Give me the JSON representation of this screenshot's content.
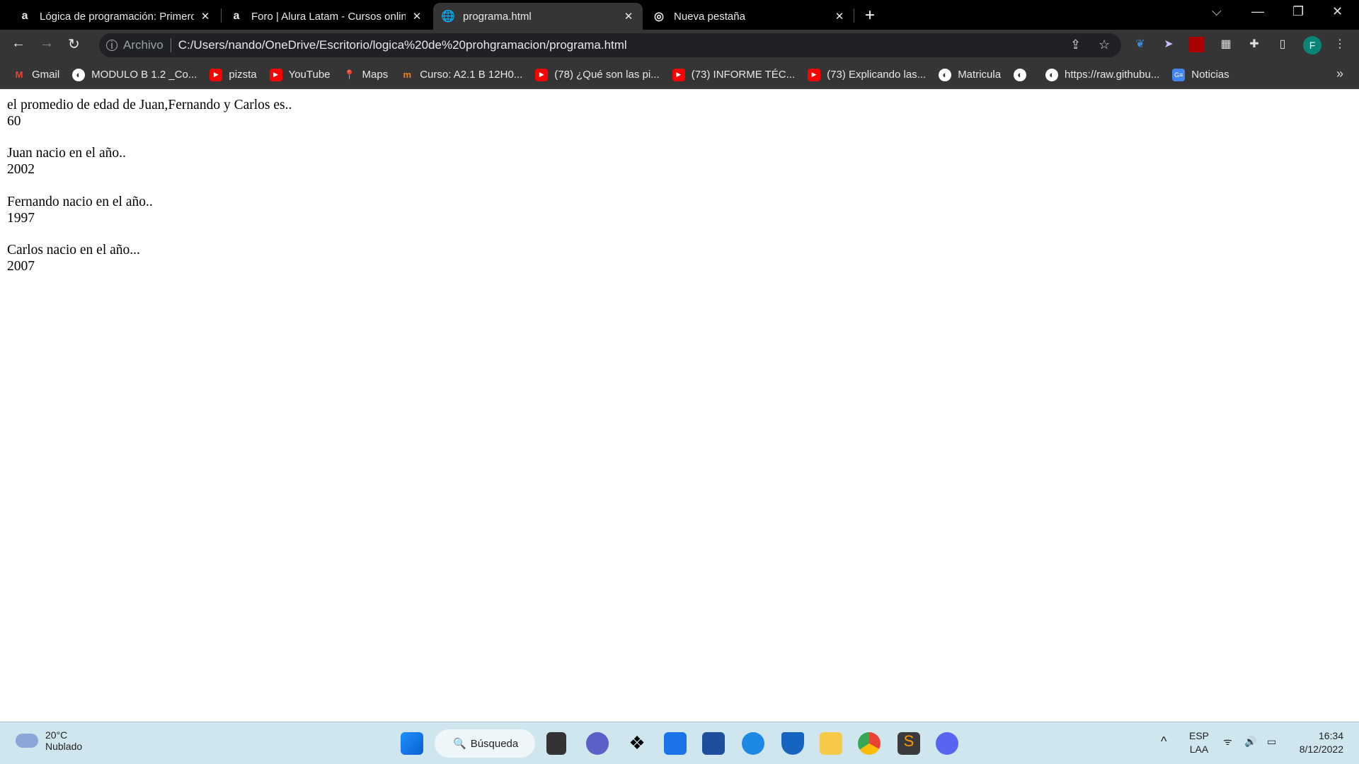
{
  "browser": {
    "tabs": [
      {
        "title": "Lógica de programación: Primeros",
        "icon": "alura-icon",
        "active": false
      },
      {
        "title": "Foro | Alura Latam - Cursos online",
        "icon": "alura-icon",
        "active": false
      },
      {
        "title": "programa.html",
        "icon": "globe-icon",
        "active": true
      },
      {
        "title": "Nueva pestaña",
        "icon": "chrome-icon",
        "active": false
      }
    ],
    "address": {
      "scheme_label": "Archivo",
      "url": "C:/Users/nando/OneDrive/Escritorio/logica%20de%20prohgramacion/programa.html"
    },
    "profile_initial": "F",
    "bookmarks": [
      {
        "label": "Gmail",
        "icon": "gmail-icon"
      },
      {
        "label": "MODULO B 1.2 _Co...",
        "icon": "globe-icon"
      },
      {
        "label": "pizsta",
        "icon": "youtube-icon"
      },
      {
        "label": "YouTube",
        "icon": "youtube-icon"
      },
      {
        "label": "Maps",
        "icon": "maps-icon"
      },
      {
        "label": "Curso: A2.1 B 12H0...",
        "icon": "moodle-icon"
      },
      {
        "label": "(78) ¿Qué son las pi...",
        "icon": "youtube-icon"
      },
      {
        "label": "(73) INFORME TÉC...",
        "icon": "youtube-icon"
      },
      {
        "label": "(73) Explicando las...",
        "icon": "youtube-icon"
      },
      {
        "label": "Matricula",
        "icon": "globe-icon"
      },
      {
        "label": "",
        "icon": "globe-icon"
      },
      {
        "label": "https://raw.githubu...",
        "icon": "globe-icon"
      },
      {
        "label": "Noticias",
        "icon": "google-news-icon"
      }
    ]
  },
  "page": {
    "lines": [
      {
        "label": "el promedio de edad de Juan,Fernando y Carlos es..",
        "value": "60"
      },
      {
        "label": "Juan nacio en el año..",
        "value": "2002"
      },
      {
        "label": "Fernando nacio en el año..",
        "value": "1997"
      },
      {
        "label": "Carlos nacio en el año...",
        "value": "2007"
      }
    ]
  },
  "taskbar": {
    "weather": {
      "temp": "20°C",
      "condition": "Nublado"
    },
    "search_label": "Búsqueda",
    "language": {
      "top": "ESP",
      "bottom": "LAA"
    },
    "time": "16:34",
    "date": "8/12/2022"
  }
}
